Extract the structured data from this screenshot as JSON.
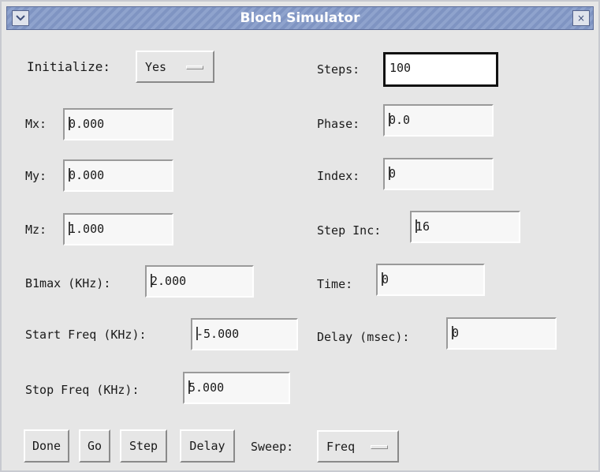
{
  "window": {
    "title": "Bloch Simulator",
    "menu_icon": "chevron-down-icon",
    "close_icon": "close-icon",
    "close_glyph": "×"
  },
  "labels": {
    "initialize": "Initialize:",
    "steps": "Steps:",
    "mx": "Mx:",
    "phase": "Phase:",
    "my": "My:",
    "index": "Index:",
    "mz": "Mz:",
    "step_inc": "Step Inc:",
    "b1max": "B1max (KHz):",
    "time": "Time:",
    "start_freq": "Start Freq (KHz):",
    "delay_msec": "Delay (msec):",
    "stop_freq": "Stop Freq (KHz):",
    "sweep": "Sweep:"
  },
  "values": {
    "initialize": "Yes",
    "steps": "100",
    "mx": "0.000",
    "phase": "0.0",
    "my": "0.000",
    "index": "0",
    "mz": "1.000",
    "step_inc": "16",
    "b1max": "2.000",
    "time": "0",
    "start_freq": "-5.000",
    "delay_msec": "0",
    "stop_freq": "5.000",
    "sweep": "Freq"
  },
  "buttons": {
    "done": "Done",
    "go": "Go",
    "step": "Step",
    "delay": "Delay"
  }
}
